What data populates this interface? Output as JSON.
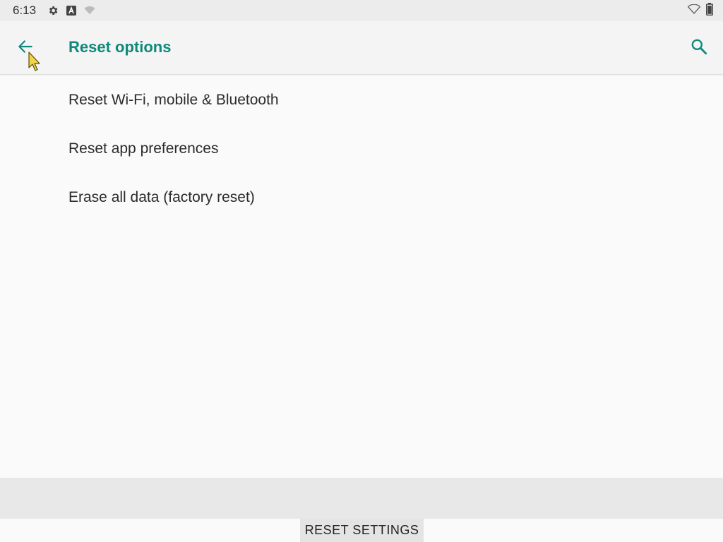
{
  "status_bar": {
    "time": "6:13",
    "icons": [
      "settings-icon",
      "a-box-icon",
      "wifi-off-icon"
    ],
    "right_icons": [
      "wifi-icon",
      "battery-icon"
    ]
  },
  "header": {
    "title": "Reset options",
    "back_icon": "arrow-back-icon",
    "search_icon": "search-icon"
  },
  "options": [
    {
      "label": "Reset Wi-Fi, mobile & Bluetooth"
    },
    {
      "label": "Reset app preferences"
    },
    {
      "label": "Erase all data (factory reset)"
    }
  ],
  "footer": {
    "button_label": "RESET SETTINGS"
  },
  "colors": {
    "accent": "#10897b",
    "background": "#fafafa",
    "status_bar": "#ececec",
    "app_bar": "#f4f4f4"
  }
}
